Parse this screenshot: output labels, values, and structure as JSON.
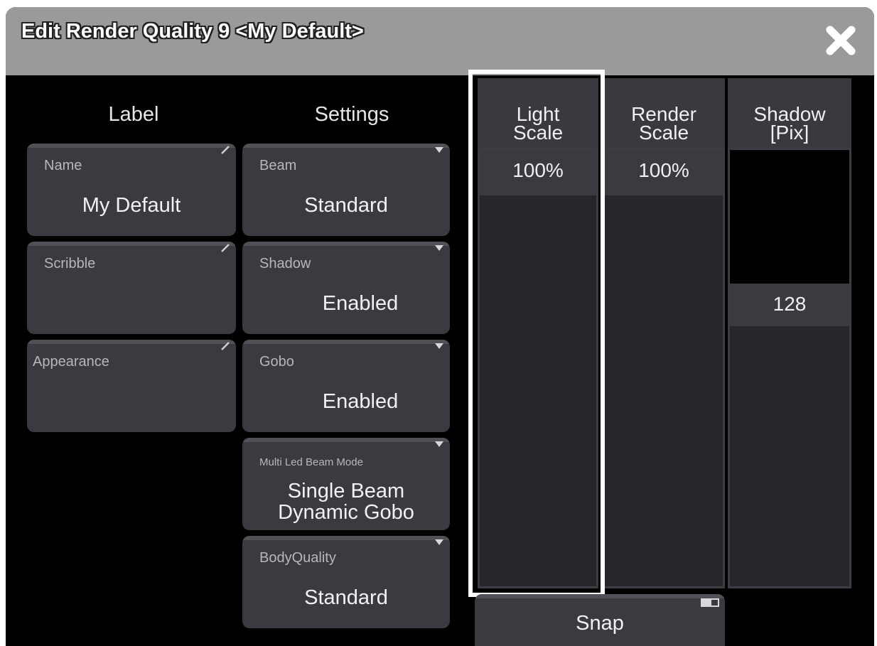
{
  "window": {
    "title": "Edit Render Quality 9 <My Default>",
    "close_icon": "close-icon"
  },
  "headers": {
    "label": "Label",
    "settings": "Settings"
  },
  "label_fields": [
    {
      "label": "Name",
      "value": "My Default"
    },
    {
      "label": "Scribble",
      "value": ""
    },
    {
      "label": "Appearance",
      "value": ""
    }
  ],
  "settings_fields": [
    {
      "label": "Beam",
      "value": "Standard"
    },
    {
      "label": "Shadow",
      "value": "Enabled"
    },
    {
      "label": "Gobo",
      "value": "Enabled"
    },
    {
      "label": "Multi Led Beam Mode",
      "value_line1": "Single Beam",
      "value_line2": "Dynamic Gobo"
    },
    {
      "label": "BodyQuality",
      "value": "Standard"
    }
  ],
  "columns": [
    {
      "line1": "Light",
      "line2": "Scale",
      "value": "100%"
    },
    {
      "line1": "Render",
      "line2": "Scale",
      "value": "100%"
    },
    {
      "line1": "Shadow",
      "line2": "[Pix]",
      "value": "128"
    }
  ],
  "snap": {
    "label": "Snap"
  },
  "colors": {
    "title_bar": "#9a9a9c",
    "background": "#000000",
    "button": "#3b3a40",
    "selection_outline": "#ffffff"
  }
}
